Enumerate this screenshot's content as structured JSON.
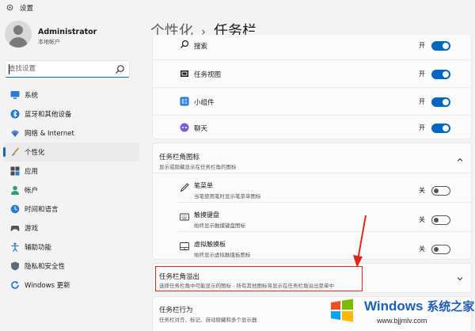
{
  "window": {
    "title": "设置"
  },
  "profile": {
    "name": "Administrator",
    "account_type": "本地帐户"
  },
  "search": {
    "placeholder": "查找设置"
  },
  "sidebar": {
    "items": [
      {
        "label": "系统",
        "icon": "monitor-icon",
        "active": false
      },
      {
        "label": "蓝牙和其他设备",
        "icon": "bluetooth-icon",
        "active": false
      },
      {
        "label": "网络 & Internet",
        "icon": "wifi-icon",
        "active": false
      },
      {
        "label": "个性化",
        "icon": "brush-icon",
        "active": true
      },
      {
        "label": "应用",
        "icon": "apps-icon",
        "active": false
      },
      {
        "label": "帐户",
        "icon": "person-icon",
        "active": false
      },
      {
        "label": "时间和语言",
        "icon": "globe-clock-icon",
        "active": false
      },
      {
        "label": "游戏",
        "icon": "gamepad-icon",
        "active": false
      },
      {
        "label": "辅助功能",
        "icon": "accessibility-icon",
        "active": false
      },
      {
        "label": "隐私和安全性",
        "icon": "shield-icon",
        "active": false
      },
      {
        "label": "Windows 更新",
        "icon": "update-icon",
        "active": false
      }
    ]
  },
  "breadcrumb": {
    "parent": "个性化",
    "separator": "›",
    "current": "任务栏"
  },
  "taskbar_items": [
    {
      "label": "搜索",
      "state": "开",
      "on": true
    },
    {
      "label": "任务视图",
      "state": "开",
      "on": true
    },
    {
      "label": "小组件",
      "state": "开",
      "on": true
    },
    {
      "label": "聊天",
      "state": "开",
      "on": true
    }
  ],
  "corner_icons": {
    "title": "任务栏角图标",
    "description": "显示或隐藏显示在任务栏角的图标",
    "items": [
      {
        "label": "笔菜单",
        "description": "当笔使用笔时显示笔菜单图标",
        "state": "关",
        "on": false
      },
      {
        "label": "触摸键盘",
        "description": "始终显示触摸键盘图标",
        "state": "关",
        "on": false
      },
      {
        "label": "虚拟触摸板",
        "description": "始终显示虚拟触摸板图标",
        "state": "关",
        "on": false
      }
    ]
  },
  "corner_overflow": {
    "title": "任务栏角溢出",
    "description": "选择任务栏角中可能显示的图标 - 所有其他图标将显示在任务栏角溢出菜单中"
  },
  "behaviors": {
    "title": "任务栏行为",
    "description": "任务栏对齐、标记、自动隐藏和多个显示器"
  },
  "watermark": {
    "brand": "Windows",
    "brand_cn": "系统之家",
    "url": "www.bjjmlv.com"
  },
  "colors": {
    "accent": "#0067c0",
    "highlight": "#e0261b",
    "watermark": "#1c5fb8"
  }
}
